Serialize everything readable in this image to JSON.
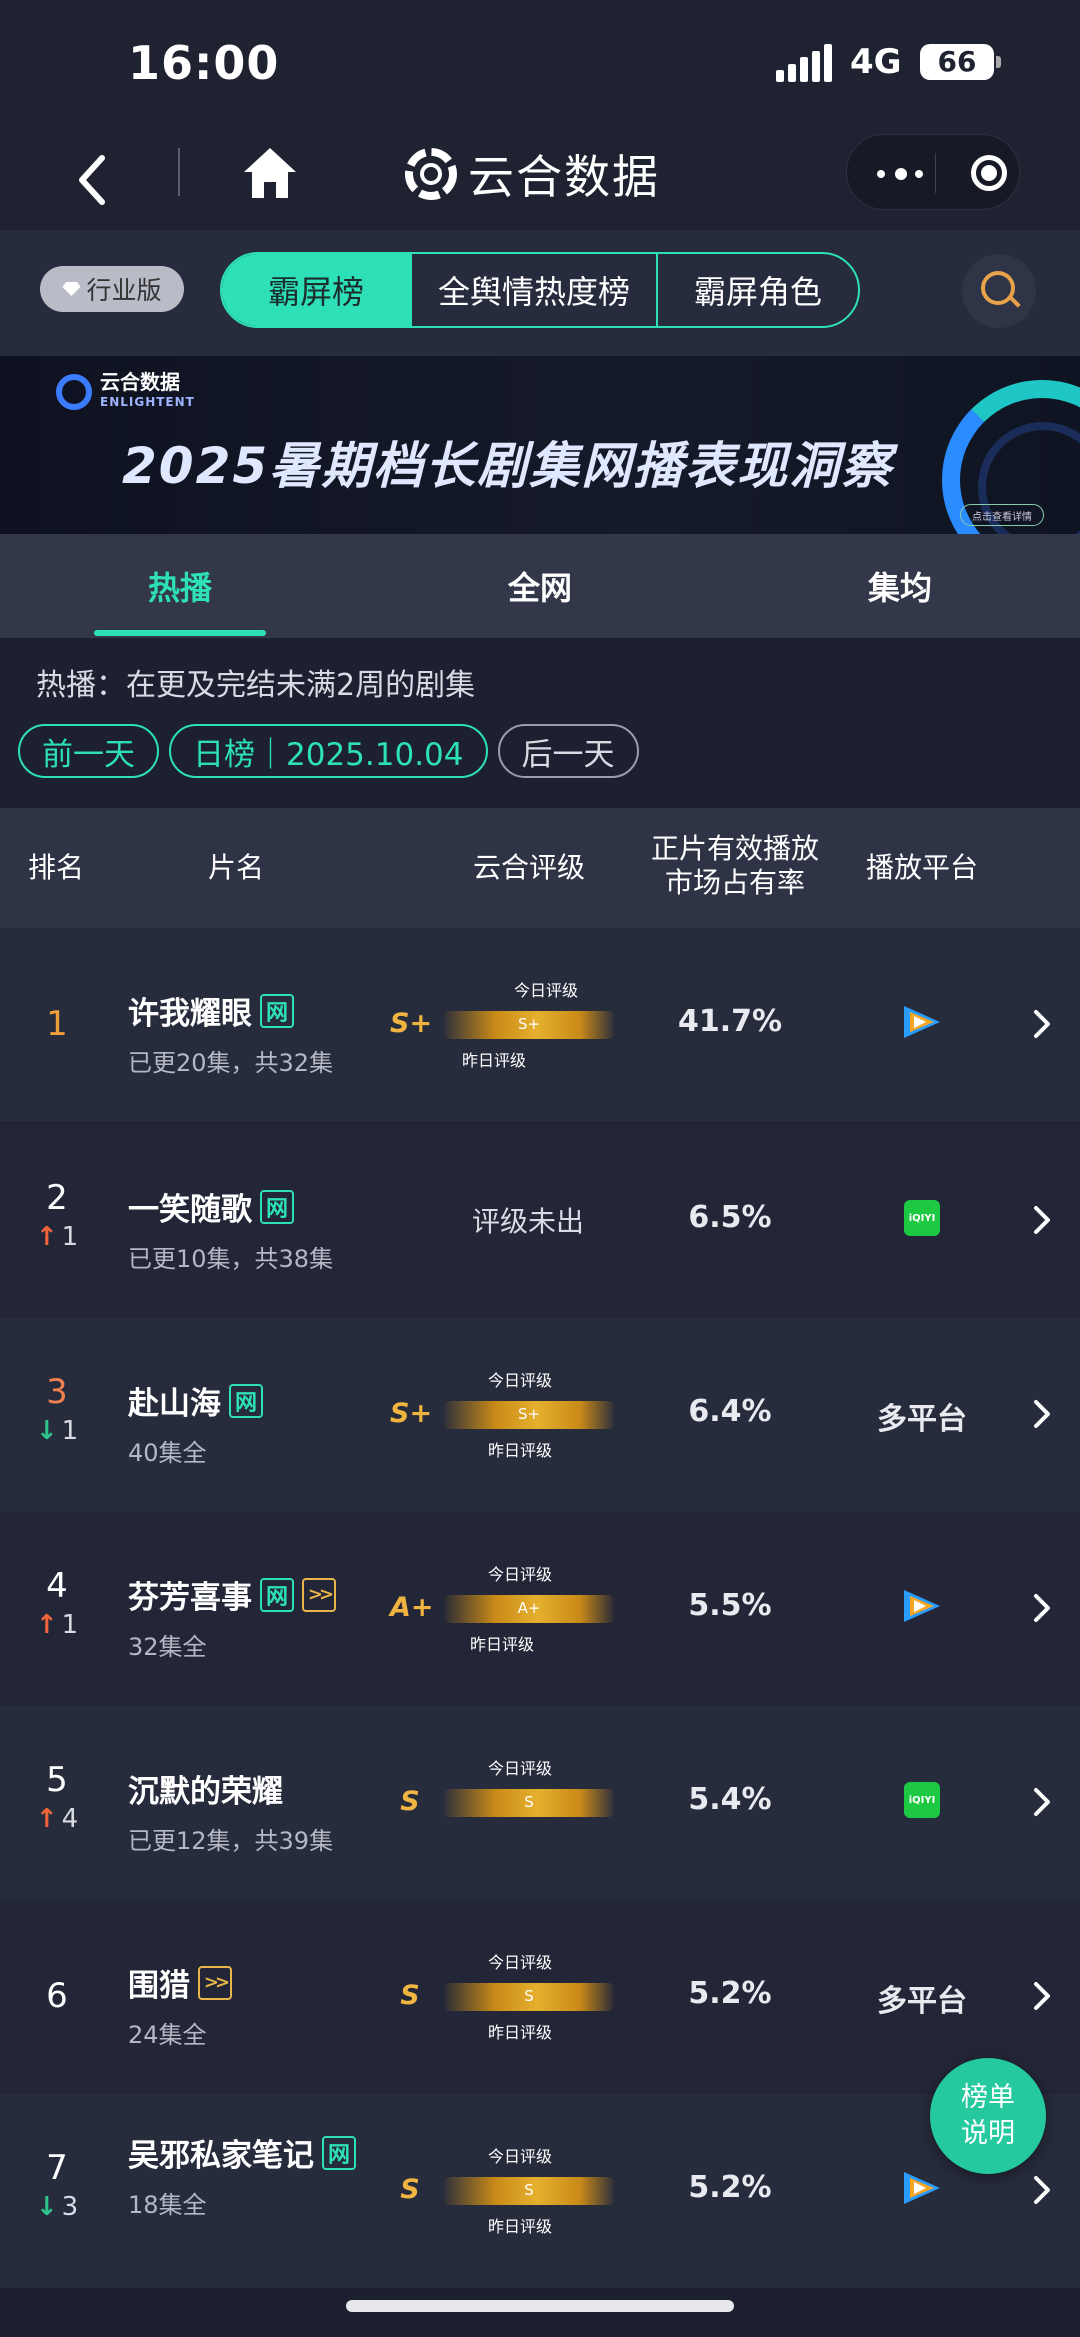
{
  "status_bar": {
    "time": "16:00",
    "network": "4G",
    "battery": "66"
  },
  "nav": {
    "brand": "云合数据"
  },
  "top": {
    "industry_label": "行业版",
    "segments": [
      "霸屏榜",
      "全舆情热度榜",
      "霸屏角色"
    ],
    "active_segment": 0
  },
  "banner": {
    "logo_text": "云合数据",
    "logo_sub": "ENLIGHTENT",
    "title": "2025暑期档长剧集网播表现洞察",
    "pill": "点击查看详情"
  },
  "tabs": {
    "items": [
      "热播",
      "全网",
      "集均"
    ],
    "active": 0
  },
  "info": "热播：在更及完结未满2周的剧集",
  "dates": {
    "prev": "前一天",
    "current": "日榜｜2025.10.04",
    "next": "后一天"
  },
  "table_header": {
    "rank": "排名",
    "title": "片名",
    "rating": "云合评级",
    "share_line1": "正片有效播放",
    "share_line2": "市场占有率",
    "platform": "播放平台"
  },
  "gauge_labels": {
    "today": "今日评级",
    "yesterday": "昨日评级"
  },
  "rows": [
    {
      "rank": "1",
      "change": "",
      "title": "许我耀眼",
      "tags": [
        "网"
      ],
      "subtitle": "已更20集，共32集",
      "level": "S+",
      "gauge_text": "S+",
      "has_today": true,
      "has_yest": true,
      "share": "41.7%",
      "platform": "tencent-video-icon",
      "platform_text": ""
    },
    {
      "rank": "2",
      "change": "1",
      "change_dir": "up",
      "title": "一笑随歌",
      "tags": [
        "网"
      ],
      "subtitle": "已更10集，共38集",
      "level": "",
      "not_rated": "评级未出",
      "share": "6.5%",
      "platform": "iqiyi-icon",
      "platform_text": ""
    },
    {
      "rank": "3",
      "change": "1",
      "change_dir": "down",
      "title": "赴山海",
      "tags": [
        "网"
      ],
      "subtitle": "40集全",
      "level": "S+",
      "gauge_text": "S+",
      "has_today": true,
      "has_yest": true,
      "share": "6.4%",
      "platform": "",
      "platform_text": "多平台"
    },
    {
      "rank": "4",
      "change": "1",
      "change_dir": "up",
      "title": "芬芳喜事",
      "tags": [
        "网",
        "play"
      ],
      "subtitle": "32集全",
      "level": "A+",
      "gauge_text": "A+",
      "has_today": true,
      "has_yest": true,
      "share": "5.5%",
      "platform": "tencent-video-icon",
      "platform_text": ""
    },
    {
      "rank": "5",
      "change": "4",
      "change_dir": "up",
      "title": "沉默的荣耀",
      "tags": [],
      "subtitle": "已更12集，共39集",
      "level": "S",
      "gauge_text": "S",
      "has_today": true,
      "has_yest": false,
      "share": "5.4%",
      "platform": "iqiyi-icon",
      "platform_text": ""
    },
    {
      "rank": "6",
      "change": "",
      "title": "围猎",
      "tags": [
        "play"
      ],
      "subtitle": "24集全",
      "level": "S",
      "gauge_text": "S",
      "has_today": true,
      "has_yest": true,
      "share": "5.2%",
      "platform": "",
      "platform_text": "多平台"
    },
    {
      "rank": "7",
      "change": "3",
      "change_dir": "down",
      "title": "吴邪私家笔记",
      "tags": [
        "网"
      ],
      "subtitle": "18集全",
      "level": "S",
      "gauge_text": "S",
      "has_today": true,
      "has_yest": true,
      "share": "5.2%",
      "platform": "tencent-video-icon",
      "platform_text": ""
    }
  ],
  "iqiyi_text": "iQIYI",
  "explain_button": {
    "line1": "榜单",
    "line2": "说明"
  },
  "colors": {
    "accent": "#2ee0b8",
    "gold": "#f0b440",
    "up": "#f0643a",
    "down": "#2ec48c"
  }
}
